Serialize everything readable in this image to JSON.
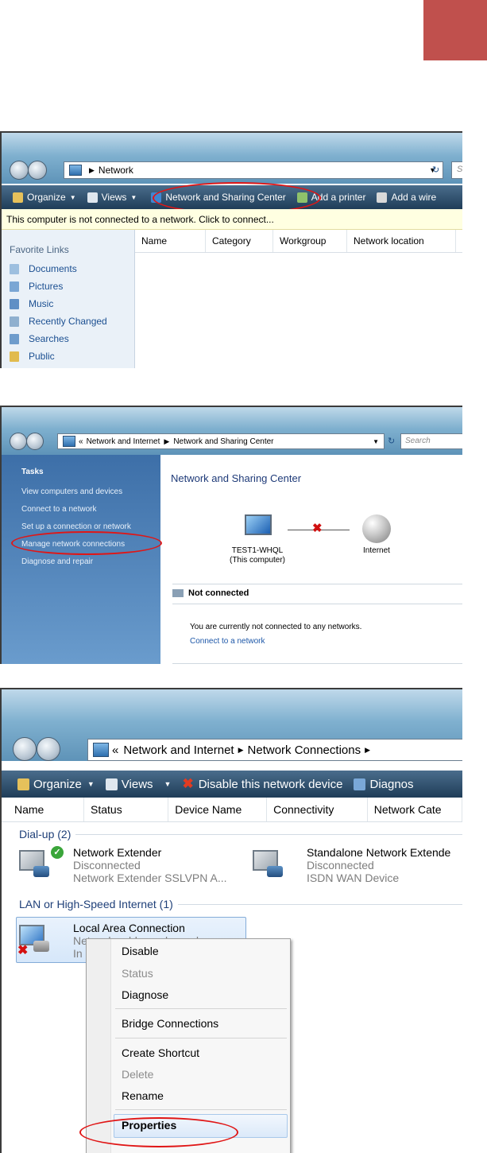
{
  "decor": {
    "accent_color": "#c0504d"
  },
  "shot1": {
    "address": {
      "crumb": "Network"
    },
    "search": {
      "placeholder": "S"
    },
    "toolbar": {
      "organize": "Organize",
      "views": "Views",
      "network_sharing_center": "Network and Sharing Center",
      "add_printer": "Add a printer",
      "add_wireless": "Add a wire"
    },
    "infobar": "This computer is not connected to a network. Click to connect...",
    "favorites": {
      "title": "Favorite Links",
      "items": [
        "Documents",
        "Pictures",
        "Music",
        "Recently Changed",
        "Searches",
        "Public"
      ]
    },
    "columns": [
      "Name",
      "Category",
      "Workgroup",
      "Network location"
    ]
  },
  "shot2": {
    "address": {
      "crumb1": "Network and Internet",
      "crumb2": "Network and Sharing Center"
    },
    "search": {
      "placeholder": "Search"
    },
    "tasks": {
      "title": "Tasks",
      "items": [
        "View computers and devices",
        "Connect to a network",
        "Set up a connection or network",
        "Manage network connections",
        "Diagnose and repair"
      ]
    },
    "main": {
      "title": "Network and Sharing Center",
      "computer_name": "TEST1-WHQL",
      "computer_sub": "(This computer)",
      "internet": "Internet",
      "status_heading": "Not connected",
      "status_text": "You are currently not connected to any networks.",
      "connect_link": "Connect to a network"
    }
  },
  "shot3": {
    "address": {
      "crumb1": "Network and Internet",
      "crumb2": "Network Connections"
    },
    "toolbar": {
      "organize": "Organize",
      "views": "Views",
      "disable": "Disable this network device",
      "diagnose": "Diagnos"
    },
    "columns": [
      "Name",
      "Status",
      "Device Name",
      "Connectivity",
      "Network Cate"
    ],
    "groups": {
      "dialup": "Dial-up (2)",
      "lan": "LAN or High-Speed Internet (1)"
    },
    "devices": [
      {
        "name": "Network Extender",
        "status": "Disconnected",
        "device": "Network Extender SSLVPN A..."
      },
      {
        "name": "Standalone Network Extende",
        "status": "Disconnected",
        "device": "ISDN WAN Device"
      },
      {
        "name": "Local Area Connection",
        "status": "Network cable unplugged",
        "device": "In"
      }
    ],
    "context_menu": [
      "Disable",
      "Status",
      "Diagnose",
      "Bridge Connections",
      "Create Shortcut",
      "Delete",
      "Rename",
      "Properties"
    ]
  }
}
